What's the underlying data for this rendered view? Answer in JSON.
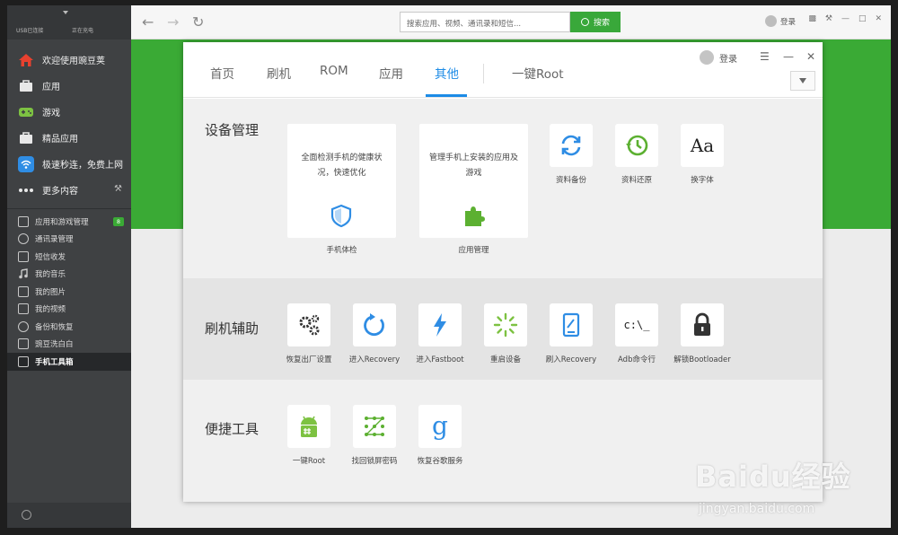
{
  "sidebar": {
    "status_usb": "USB已连接",
    "status_charge": "正在充电",
    "main_items": [
      {
        "label": "欢迎使用豌豆荚",
        "icon": "home-icon"
      },
      {
        "label": "应用",
        "icon": "bag-icon"
      },
      {
        "label": "游戏",
        "icon": "gamepad-icon"
      },
      {
        "label": "精品应用",
        "icon": "bag-icon"
      },
      {
        "label": "极速秒连，免费上网",
        "icon": "wifi-icon"
      },
      {
        "label": "更多内容",
        "icon": "more-icon"
      }
    ],
    "sub_items": [
      {
        "label": "应用和游戏管理",
        "badge": "8"
      },
      {
        "label": "通讯录管理"
      },
      {
        "label": "短信收发"
      },
      {
        "label": "我的音乐"
      },
      {
        "label": "我的图片"
      },
      {
        "label": "我的视频"
      },
      {
        "label": "备份和恢复"
      },
      {
        "label": "豌豆洗白白"
      },
      {
        "label": "手机工具箱"
      }
    ]
  },
  "topbar": {
    "search_placeholder": "搜索应用、视频、通讯录和短信...",
    "search_button": "搜索",
    "login": "登录"
  },
  "dialog": {
    "tabs": [
      "首页",
      "刷机",
      "ROM",
      "应用",
      "其他",
      "一键Root"
    ],
    "active_tab": "其他",
    "login": "登录",
    "sections": {
      "device": {
        "title": "设备管理",
        "cards": [
          {
            "desc": "全面检测手机的健康状况，快速优化",
            "label": "手机体检"
          },
          {
            "desc": "管理手机上安装的应用及游戏",
            "label": "应用管理"
          }
        ],
        "tools": [
          {
            "label": "资料备份"
          },
          {
            "label": "资料还原"
          },
          {
            "label": "换字体",
            "glyph": "Aa"
          }
        ]
      },
      "flash": {
        "title": "刷机辅助",
        "tools": [
          {
            "label": "恢复出厂设置"
          },
          {
            "label": "进入Recovery"
          },
          {
            "label": "进入Fastboot"
          },
          {
            "label": "重启设备"
          },
          {
            "label": "刷入Recovery"
          },
          {
            "label": "Adb命令行",
            "glyph": "c:\\_"
          },
          {
            "label": "解锁Bootloader"
          }
        ]
      },
      "quick": {
        "title": "便捷工具",
        "tools": [
          {
            "label": "一键Root"
          },
          {
            "label": "找回锁屏密码"
          },
          {
            "label": "恢复谷歌服务",
            "glyph": "g"
          }
        ]
      }
    }
  },
  "watermark": {
    "text": "Baidu经验",
    "url": "jingyan.baidu.com"
  },
  "colors": {
    "accent": "#3aaa35",
    "tab_active": "#1c8be6",
    "sidebar": "#3f4143"
  }
}
